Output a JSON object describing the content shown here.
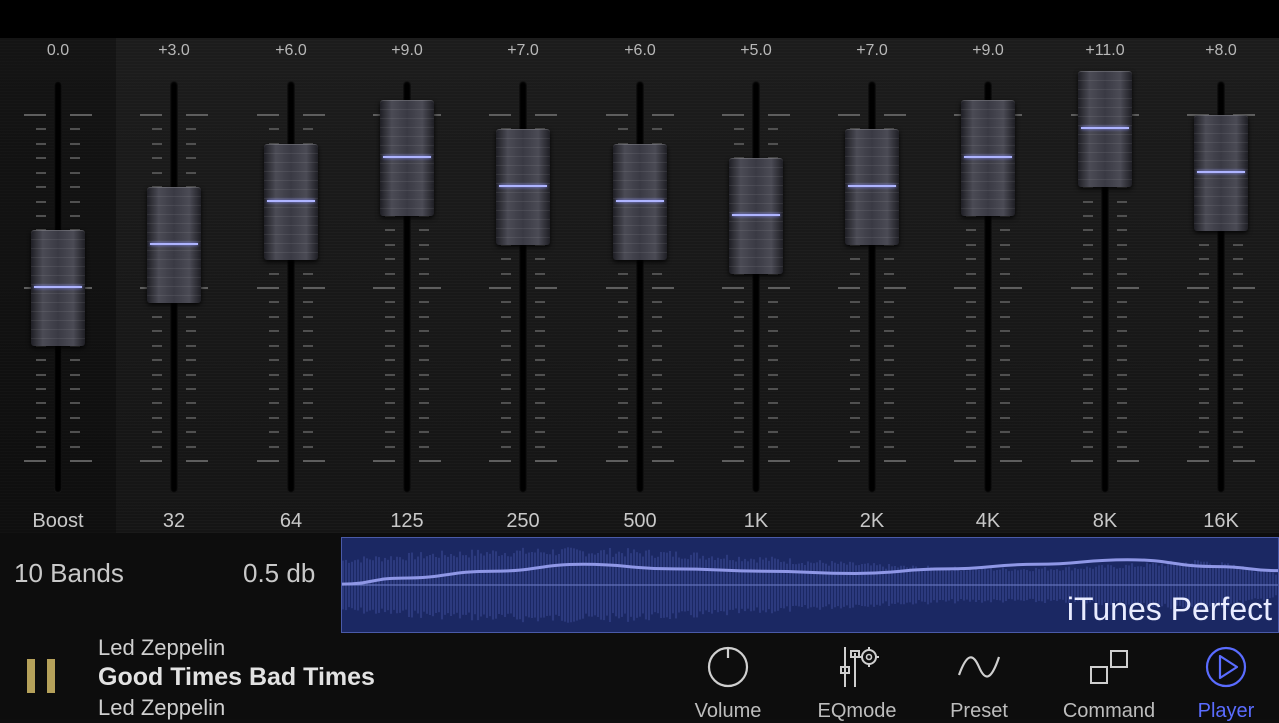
{
  "colors": {
    "accent": "#5a6cff",
    "knob_line": "#aeb4ff",
    "curve_panel": "#1b2863",
    "pause_icon": "#b5a15a"
  },
  "eq": {
    "range_db": [
      -12,
      12
    ],
    "boost": {
      "label": "Boost",
      "value_label": "0.0",
      "value": 0.0
    },
    "bands": [
      {
        "label": "32",
        "value_label": "+3.0",
        "value": 3.0
      },
      {
        "label": "64",
        "value_label": "+6.0",
        "value": 6.0
      },
      {
        "label": "125",
        "value_label": "+9.0",
        "value": 9.0
      },
      {
        "label": "250",
        "value_label": "+7.0",
        "value": 7.0
      },
      {
        "label": "500",
        "value_label": "+6.0",
        "value": 6.0
      },
      {
        "label": "1K",
        "value_label": "+5.0",
        "value": 5.0
      },
      {
        "label": "2K",
        "value_label": "+7.0",
        "value": 7.0
      },
      {
        "label": "4K",
        "value_label": "+9.0",
        "value": 9.0
      },
      {
        "label": "8K",
        "value_label": "+11.0",
        "value": 11.0
      },
      {
        "label": "16K",
        "value_label": "+8.0",
        "value": 8.0
      }
    ]
  },
  "info": {
    "bands_count": "10 Bands",
    "step": "0.5 db",
    "preset_name": "iTunes Perfect"
  },
  "now_playing": {
    "artist": "Led Zeppelin",
    "title": "Good Times Bad Times",
    "album": "Led Zeppelin",
    "state_icon": "pause-icon"
  },
  "nav": [
    {
      "name": "volume",
      "label": "Volume",
      "icon": "knob-icon"
    },
    {
      "name": "eqmode",
      "label": "EQmode",
      "icon": "slider-gear-icon"
    },
    {
      "name": "preset",
      "label": "Preset",
      "icon": "wave-icon"
    },
    {
      "name": "command",
      "label": "Command",
      "icon": "squares-icon"
    },
    {
      "name": "player",
      "label": "Player",
      "icon": "play-circle-icon",
      "active": true
    }
  ]
}
